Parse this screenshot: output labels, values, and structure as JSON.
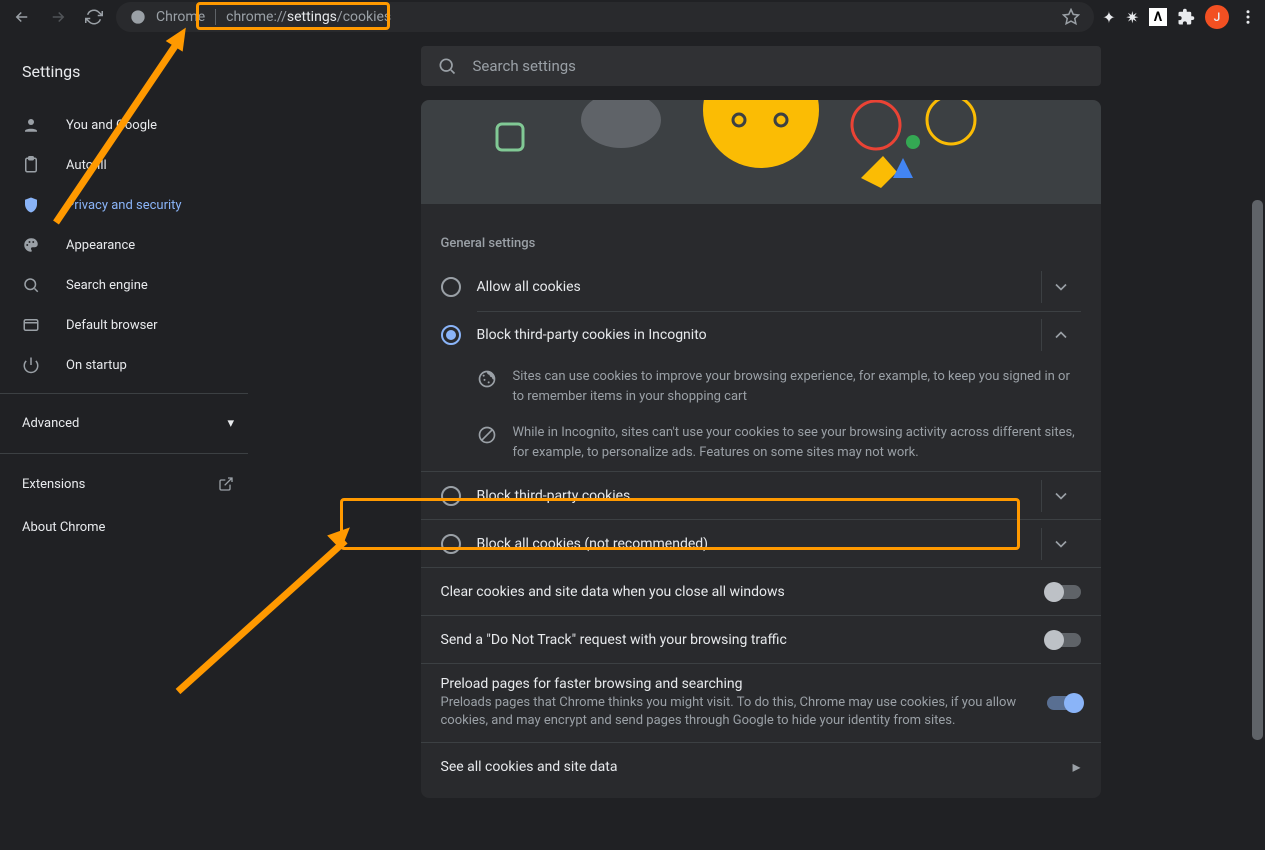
{
  "omnibox": {
    "secure_label": "Chrome",
    "url_muted_prefix": "chrome://",
    "url_strong": "settings",
    "url_muted_suffix": "/cookies"
  },
  "avatar_letter": "J",
  "app_title": "Settings",
  "search_placeholder": "Search settings",
  "sidebar": {
    "items": [
      {
        "icon": "person-icon",
        "label": "You and Google"
      },
      {
        "icon": "autofill-icon",
        "label": "Autofill"
      },
      {
        "icon": "shield-icon",
        "label": "Privacy and security"
      },
      {
        "icon": "palette-icon",
        "label": "Appearance"
      },
      {
        "icon": "search-icon",
        "label": "Search engine"
      },
      {
        "icon": "browser-icon",
        "label": "Default browser"
      },
      {
        "icon": "power-icon",
        "label": "On startup"
      }
    ],
    "advanced": "Advanced",
    "extensions": "Extensions",
    "about": "About Chrome"
  },
  "section_header": "General settings",
  "options": [
    {
      "label": "Allow all cookies"
    },
    {
      "label": "Block third-party cookies in Incognito"
    },
    {
      "label": "Block third-party cookies"
    },
    {
      "label": "Block all cookies (not recommended)"
    }
  ],
  "details": {
    "cookie_text": "Sites can use cookies to improve your browsing experience, for example, to keep you signed in or to remember items in your shopping cart",
    "incognito_text": "While in Incognito, sites can't use your cookies to see your browsing activity across different sites, for example, to personalize ads. Features on some sites may not work."
  },
  "toggles": {
    "clear_on_close": "Clear cookies and site data when you close all windows",
    "do_not_track": "Send a \"Do Not Track\" request with your browsing traffic",
    "preload_title": "Preload pages for faster browsing and searching",
    "preload_sub": "Preloads pages that Chrome thinks you might visit. To do this, Chrome may use cookies, if you allow cookies, and may encrypt and send pages through Google to hide your identity from sites."
  },
  "see_all": "See all cookies and site data"
}
